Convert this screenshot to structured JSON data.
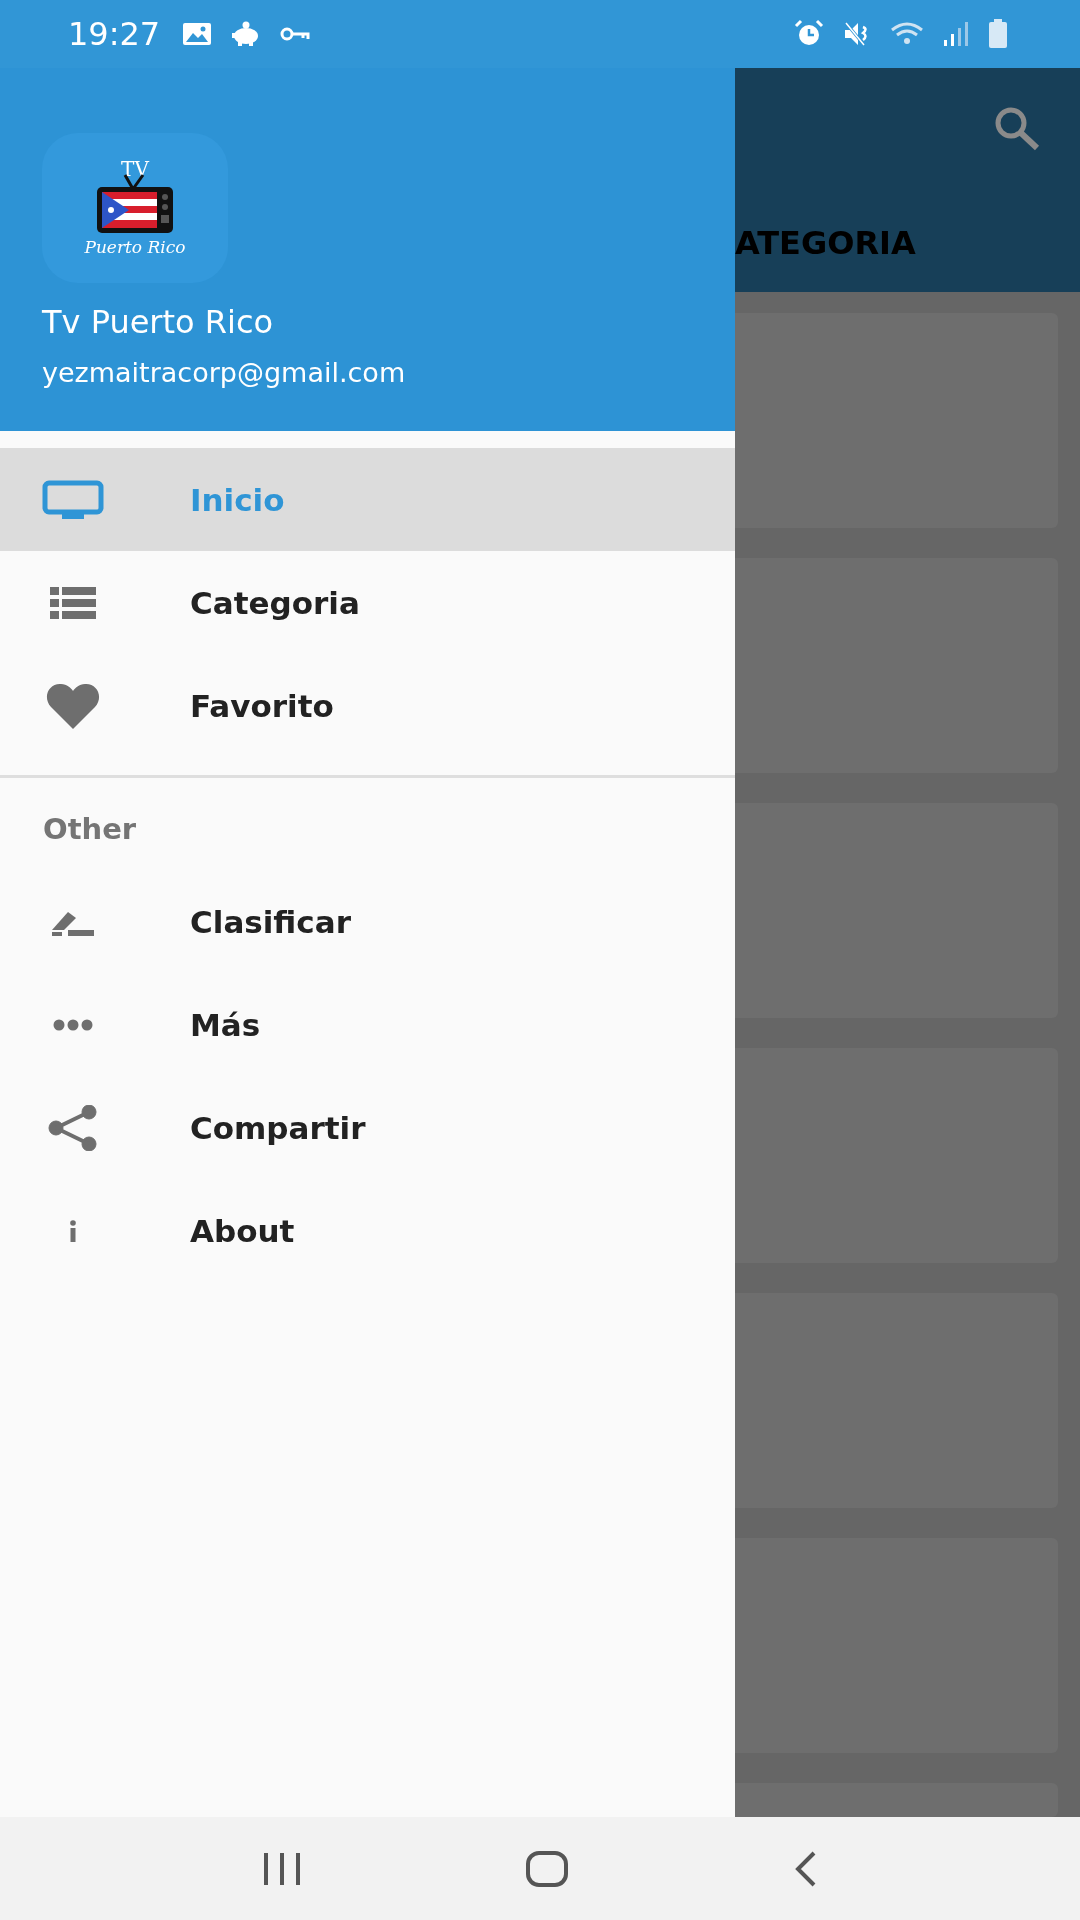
{
  "status_bar": {
    "time": "19:27"
  },
  "app_bar": {
    "tab_label": "ATEGORIA"
  },
  "drawer": {
    "logo": {
      "top_text": "TV",
      "bottom_text": "Puerto Rico"
    },
    "title": "Tv Puerto Rico",
    "email": "yezmaitracorp@gmail.com",
    "items": [
      {
        "label": "Inicio",
        "kind": "tv",
        "selected": true
      },
      {
        "label": "Categoria",
        "kind": "list",
        "selected": false
      },
      {
        "label": "Favorito",
        "kind": "heart",
        "selected": false
      }
    ],
    "section_title": "Other",
    "other_items": [
      {
        "label": "Clasificar",
        "kind": "rate",
        "selected": false
      },
      {
        "label": "Más",
        "kind": "more",
        "selected": false
      },
      {
        "label": "Compartir",
        "kind": "share",
        "selected": false
      },
      {
        "label": "About",
        "kind": "info",
        "selected": false
      }
    ]
  }
}
